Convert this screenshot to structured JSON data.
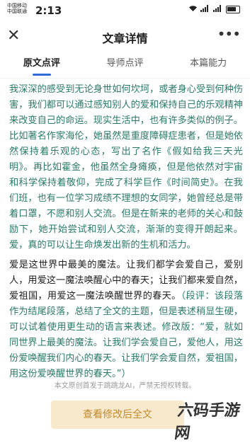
{
  "status_bar": {
    "carrier_1": "中国移动",
    "carrier_2": "中国联通",
    "time": "2:13",
    "signal_text": "4G",
    "battery": "battery"
  },
  "nav": {
    "title": "文章详情",
    "close_icon": "close-icon",
    "more_icon": "more-icon"
  },
  "tabs": [
    {
      "label": "原文点评",
      "active": true
    },
    {
      "label": "导师点评",
      "active": false
    },
    {
      "label": "本篇能力",
      "active": false
    }
  ],
  "article": {
    "p1": "我深深的感受到无论身世如何坎坷，或者身心受到何种伤害，我们都可以通过感知别人的爱和保持自己的乐观精神来改变自己的命运。现实生活中，也有许多类似的例子。比如著名作家海伦，她虽然是重度障碍症患者，但是她依然保持着乐观的心态，写出了名作《假如给我三天光明》。再比如霍金，他虽然全身瘫痪，但是他依然对宇宙和科学保持着敬仰，完成了科学巨作《时间简史》。在我们班，也有一位学习成绩不理想的女同学，她曾经总是带着口罩，不愿和别人交流。但是在新来的老师的关心和鼓励下，她开始尝试和别人交流，渐渐的变得开朗起来。爱，真的可以让生命焕发出新的生机和活力。",
    "p2_dark": "爱是这世界中最美的魔法。让我们都学会爱自己，爱别人，用爱这一魔法唤醒心中的春天；让我们都来爱自然，爱祖国，用爱这一魔法唤醒世界的春天。",
    "p2_green": "（段评：该段落作为结尾段落，总结了全文的主题，但是表述稍显生硬，可以试着使用更生动的语言来表述。修改版：“爱，就如同世界上最美的魔法。让我们学会爱自己，爱他人，用这份爱唤醒我们内心的春天。让我们学会爱自然，爱祖国，用这份爱唤醒世界的春天。”）"
  },
  "footer": {
    "note": "本文原创首发于跳跳龙AI，严禁无授权转载。",
    "button_label": "查看修改后全文",
    "watermark": "六码手游网"
  },
  "colors": {
    "accent": "#2f6bd8",
    "comment_green": "#2a7a68",
    "button_bg": "#f8e9cc",
    "button_text": "#c28a2e"
  }
}
